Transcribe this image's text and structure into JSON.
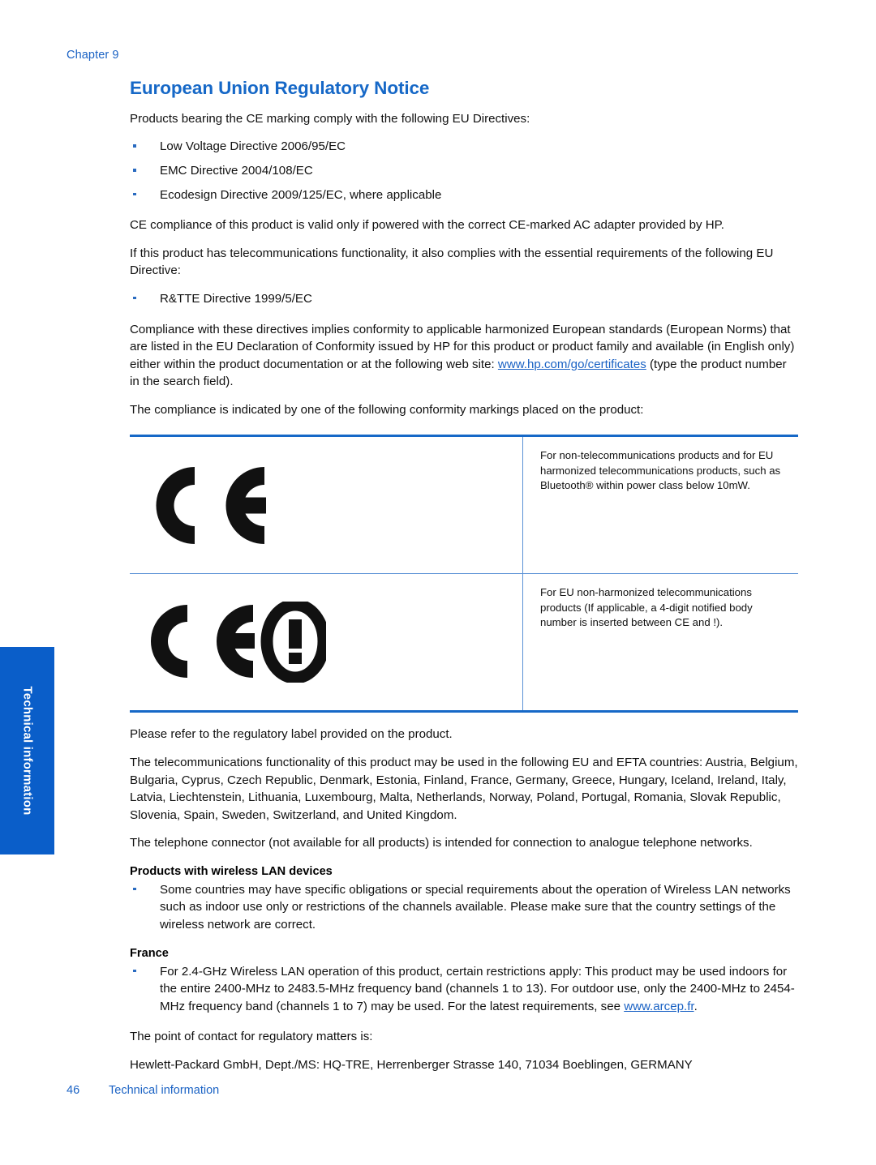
{
  "header": {
    "chapter_label": "Chapter 9"
  },
  "side_tab": {
    "label": "Technical information",
    "color": "#0a5ec9"
  },
  "title": "European Union Regulatory Notice",
  "colors": {
    "heading_blue": "#1668c7",
    "link_blue": "#1a62c4",
    "table_border_blue": "#1668c7",
    "table_inner_blue": "#5b92d6",
    "bullet_blue": "#2a6bc0"
  },
  "body": {
    "intro": "Products bearing the CE marking comply with the following EU Directives:",
    "directives": [
      "Low Voltage Directive 2006/95/EC",
      "EMC Directive 2004/108/EC",
      "Ecodesign Directive 2009/125/EC, where applicable"
    ],
    "ce_compliance": "CE compliance of this product is valid only if powered with the correct CE-marked AC adapter provided by HP.",
    "telecom_intro": "If this product has telecommunications functionality, it also complies with the essential requirements of the following EU Directive:",
    "telecom_directives": [
      "R&TTE Directive 1999/5/EC"
    ],
    "compliance_para_1": "Compliance with these directives implies conformity to applicable harmonized European standards (European Norms) that are listed in the EU Declaration of Conformity issued by HP for this product or product family and available (in English only) either within the product documentation or at the following web site: ",
    "compliance_link": "www.hp.com/go/certificates",
    "compliance_para_2": " (type the product number in the search field).",
    "markings_intro": "The compliance is indicated by one of the following conformity markings placed on the product:",
    "regulatory_label": "Please refer to the regulatory label provided on the product.",
    "countries_intro": "The telecommunications functionality of this product may be used in the following EU and EFTA countries: Austria, Belgium, Bulgaria, Cyprus, Czech Republic, Denmark, Estonia, Finland, France, Germany, Greece, Hungary, Iceland, Ireland, Italy, Latvia, Liechtenstein, Lithuania, Luxembourg, Malta, Netherlands, Norway, Poland, Portugal, Romania, Slovak Republic, Slovenia, Spain, Sweden, Switzerland, and United Kingdom.",
    "telephone_connector": "The telephone connector (not available for all products) is intended for connection to analogue telephone networks.",
    "wireless_heading": "Products with wireless LAN devices",
    "wireless_bullets": [
      "Some countries may have specific obligations or special requirements about the operation of Wireless LAN networks such as indoor use only or restrictions of the channels available. Please make sure that the country settings of the wireless network are correct."
    ],
    "france_heading": "France",
    "france_bullet_part_1": "For 2.4-GHz Wireless LAN operation of this product, certain restrictions apply: This product may be used indoors for the entire 2400-MHz to 2483.5-MHz frequency band (channels 1 to 13). For outdoor use, only the 2400-MHz to 2454-MHz frequency band (channels 1 to 7) may be used. For the latest requirements, see ",
    "france_link": "www.arcep.fr",
    "france_bullet_part_2": ".",
    "contact_intro": "The point of contact for regulatory matters is:",
    "contact_address": "Hewlett-Packard GmbH, Dept./MS: HQ-TRE, Herrenberger Strasse 140, 71034 Boeblingen, GERMANY"
  },
  "mark_table": {
    "rows": [
      {
        "mark": "ce-mark",
        "description": "For non-telecommunications products and for EU harmonized telecommunications products, such as Bluetooth® within power class below 10mW."
      },
      {
        "mark": "ce-alert-mark",
        "description": "For EU non-harmonized telecommunications products (If applicable, a 4-digit notified body number is inserted between CE and !)."
      }
    ]
  },
  "footer": {
    "page_number": "46",
    "section": "Technical information"
  }
}
